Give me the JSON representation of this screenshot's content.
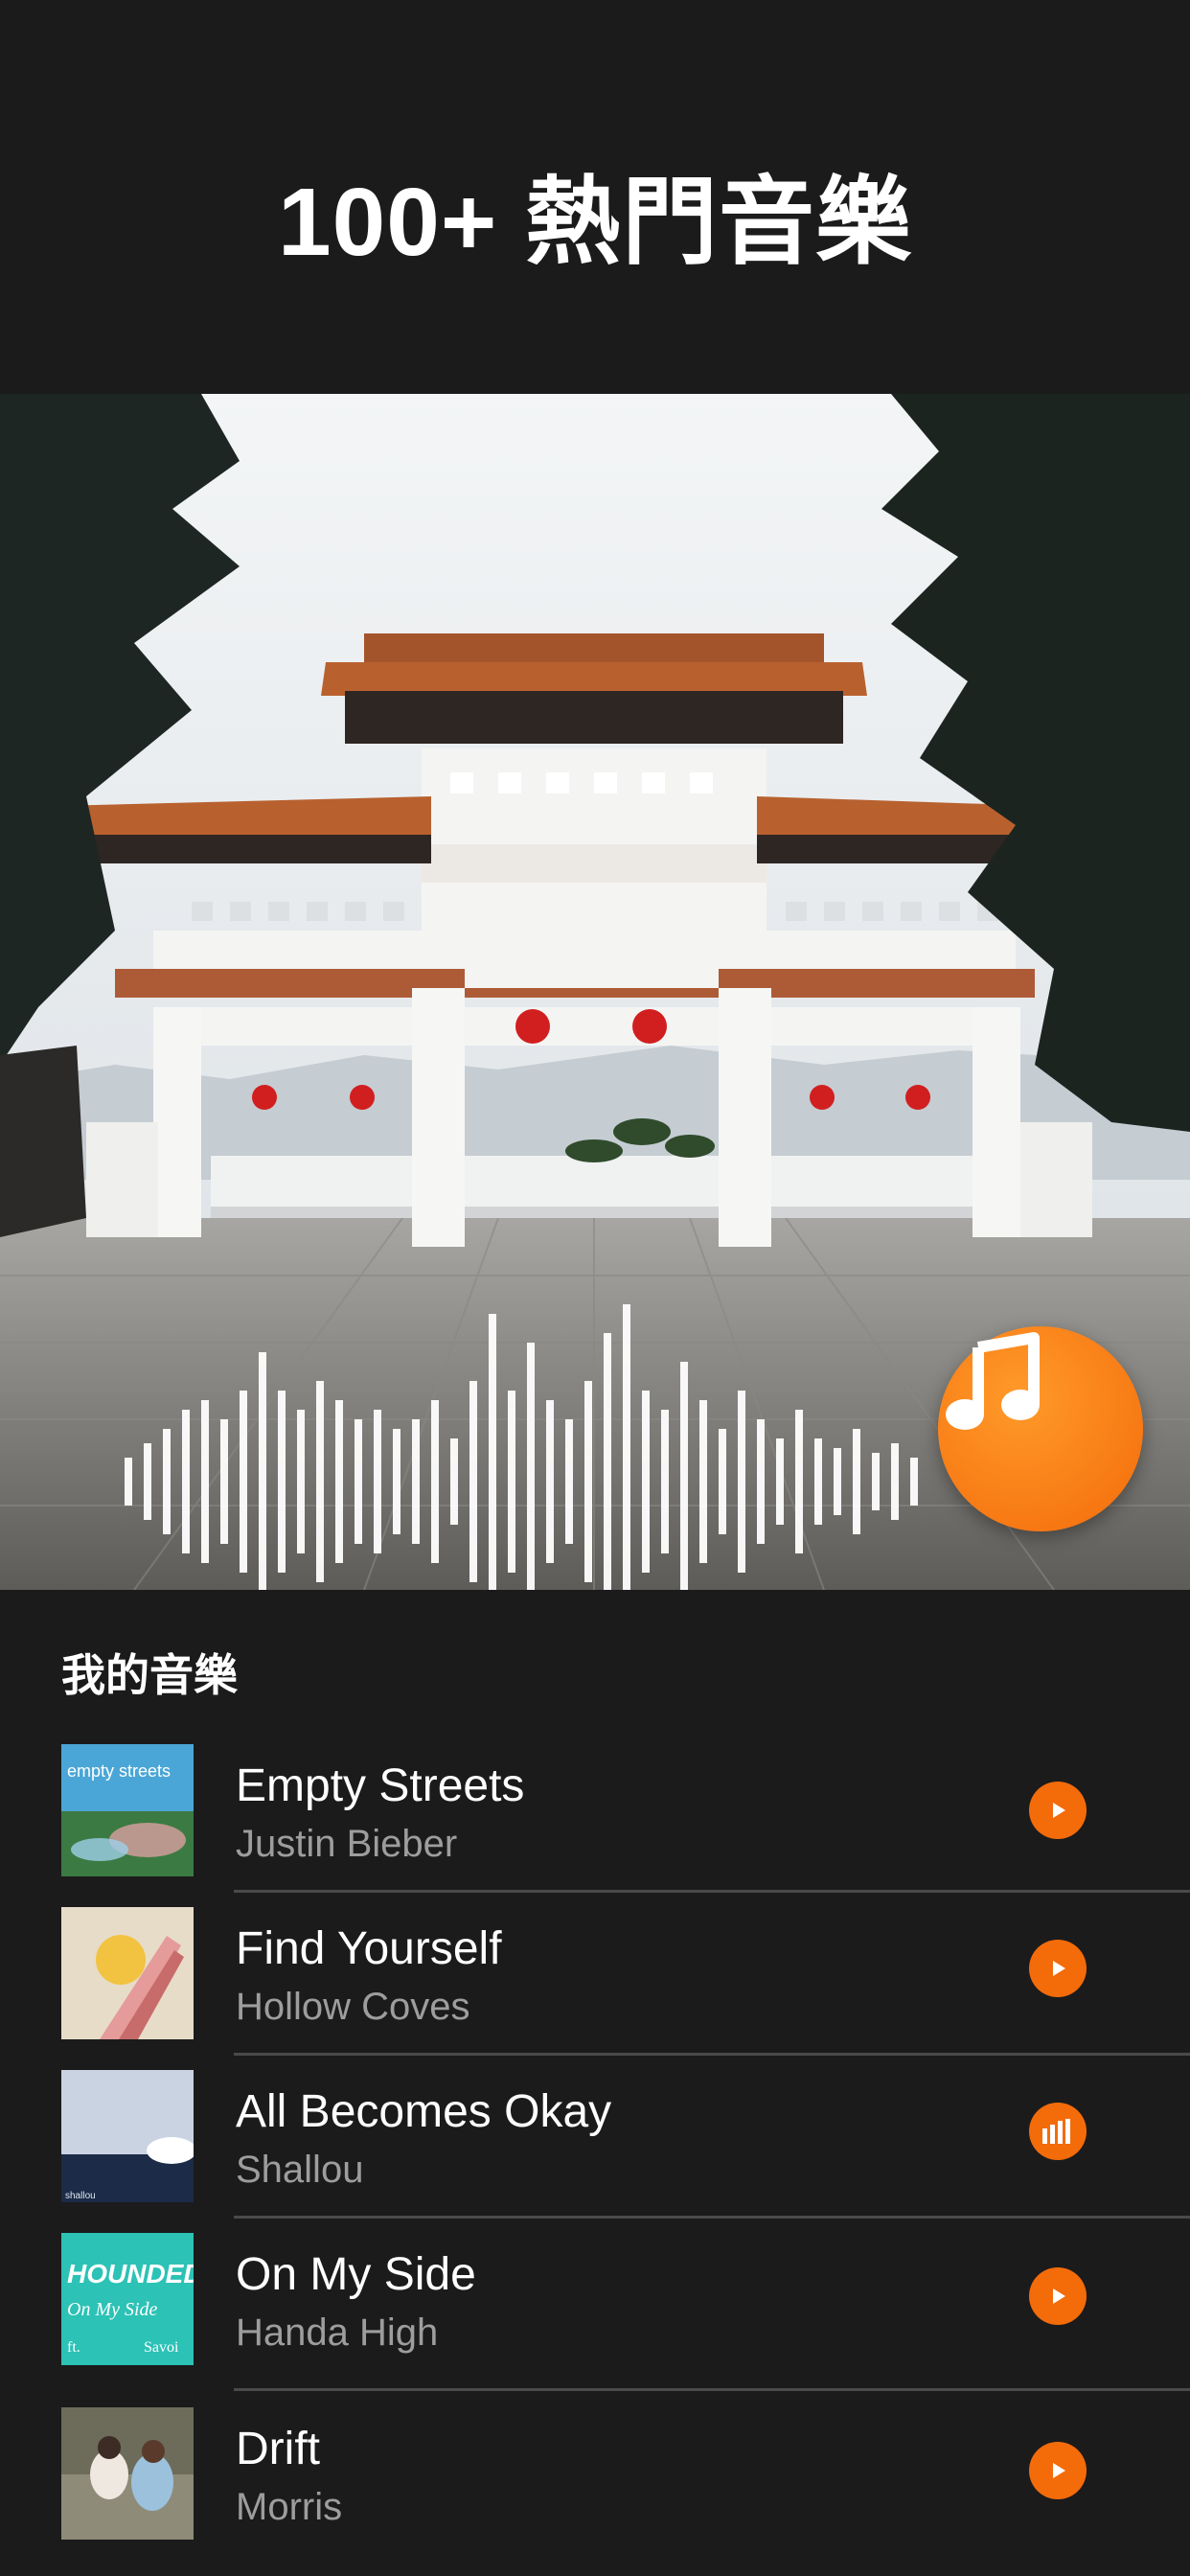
{
  "headline": "100+ 熱門音樂",
  "hero": {
    "photo_icon": "memorial-archway-photo",
    "waveform_icon": "audio-waveform-icon",
    "fab_icon": "music-note-icon"
  },
  "my_music": {
    "title": "我的音樂",
    "tracks": [
      {
        "title": "Empty Streets",
        "artist": "Justin Bieber",
        "state": "play",
        "cover_text": "empty streets"
      },
      {
        "title": "Find Yourself",
        "artist": "Hollow  Coves",
        "state": "play",
        "cover_text": ""
      },
      {
        "title": "All Becomes Okay",
        "artist": "Shallou",
        "state": "playing",
        "cover_text": "shallou"
      },
      {
        "title": "On My Side",
        "artist": "Handa High",
        "state": "play",
        "cover_text": "HOUNDED",
        "cover_text2": "On My Side",
        "cover_text3": "ft.",
        "cover_text4": "Savoi"
      },
      {
        "title": "Drift",
        "artist": "Morris",
        "state": "play",
        "cover_text": ""
      }
    ]
  },
  "colors": {
    "accent": "#f46b0a",
    "background": "#1b1b1c",
    "secondary_text": "#9d9d9d"
  }
}
